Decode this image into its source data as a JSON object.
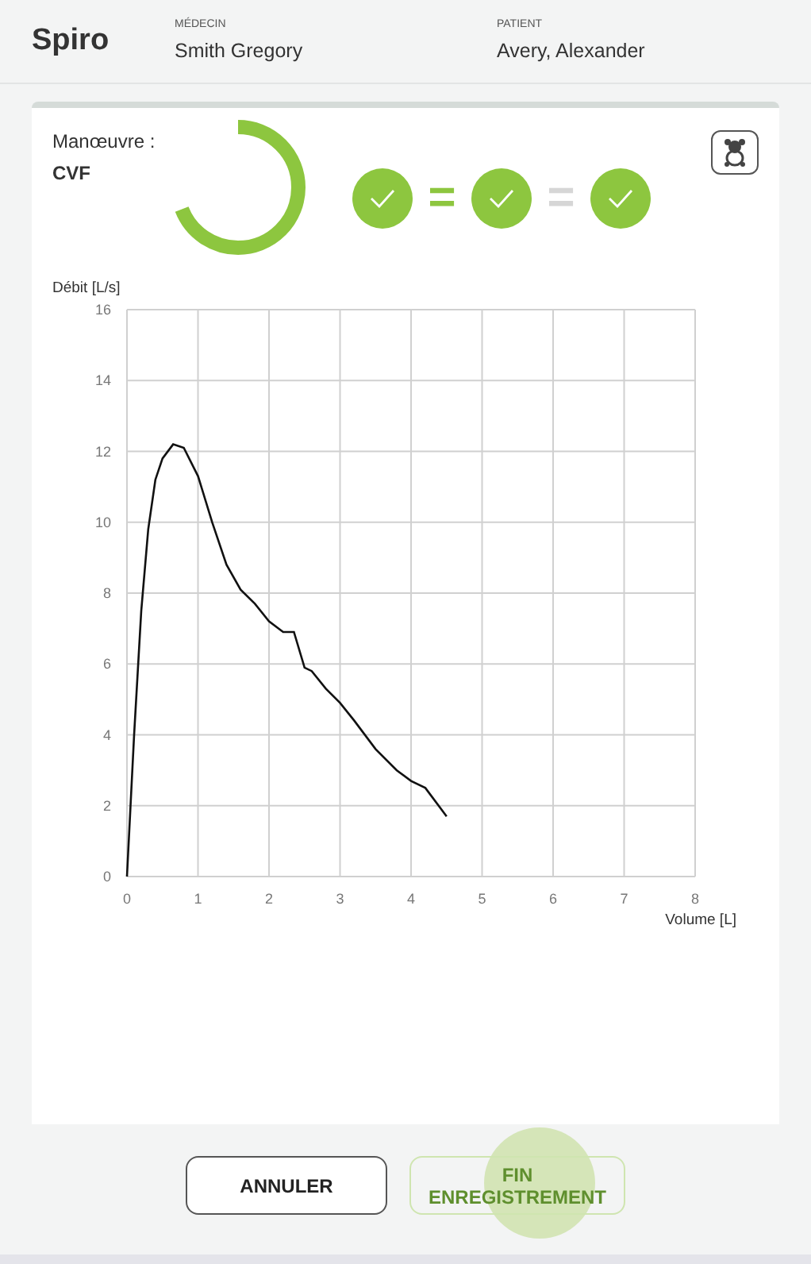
{
  "header": {
    "title": "Spiro",
    "fields": [
      {
        "label": "MÉDECIN",
        "value": "Smith Gregory"
      },
      {
        "label": "PATIENT",
        "value": "Avery, Alexander"
      }
    ]
  },
  "manoeuvre": {
    "label": "Manœuvre :",
    "value": "CVF",
    "progress": {
      "level": 0.69
    }
  },
  "attempts": [
    {
      "checked": true
    },
    {
      "checked": true
    },
    {
      "checked": true
    }
  ],
  "separators": [
    {
      "text": "=",
      "matched": true
    },
    {
      "text": "=",
      "matched": false
    }
  ],
  "chart_data": {
    "type": "line",
    "ylabel": "Débit [L/s]",
    "xlabel": "Volume [L]",
    "xlim": [
      0,
      8
    ],
    "ylim": [
      0,
      16
    ],
    "xticks": [
      0,
      1,
      2,
      3,
      4,
      5,
      6,
      7,
      8
    ],
    "yticks": [
      0,
      2,
      4,
      6,
      8,
      10,
      12,
      14,
      16
    ],
    "x": [
      0,
      0.1,
      0.2,
      0.3,
      0.4,
      0.5,
      0.65,
      0.8,
      1.0,
      1.2,
      1.4,
      1.6,
      1.8,
      2.0,
      2.2,
      2.35,
      2.5,
      2.6,
      2.8,
      3.0,
      3.2,
      3.5,
      3.8,
      4.0,
      4.2,
      4.5
    ],
    "grid": true,
    "series": [
      {
        "color": "#111111",
        "values": [
          0,
          4,
          7.5,
          9.8,
          11.2,
          11.8,
          12.2,
          12.1,
          11.3,
          10,
          8.8,
          8.1,
          7.7,
          7.2,
          6.9,
          6.9,
          5.9,
          5.8,
          5.3,
          4.9,
          4.4,
          3.6,
          3.0,
          2.7,
          2.5,
          1.7
        ]
      }
    ]
  },
  "buttons": [
    {
      "label": "ANNULER",
      "disabled": false
    },
    {
      "label": "FIN ENREGISTREMENT",
      "disabled": true,
      "touched": true
    }
  ]
}
